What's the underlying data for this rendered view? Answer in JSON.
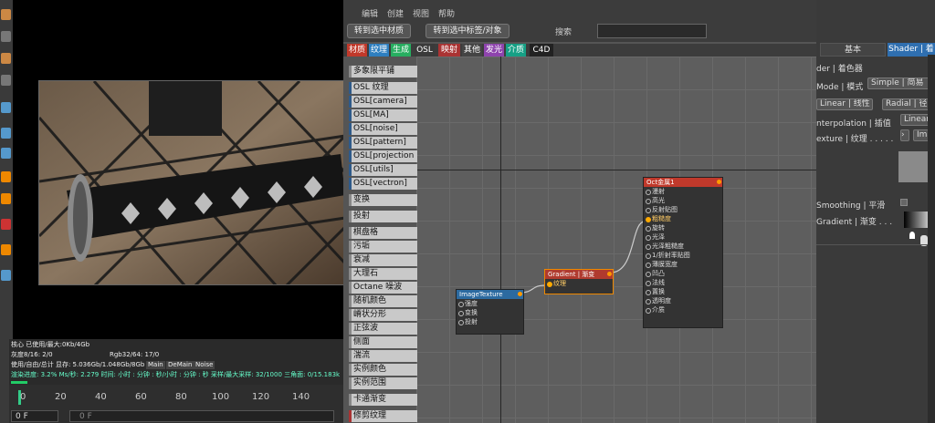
{
  "menubar": {
    "items": [
      "编辑",
      "创建",
      "视图",
      "帮助"
    ]
  },
  "toolbar": {
    "btn_material": "转到选中材质",
    "btn_tag": "转到选中标签/对象",
    "search_label": "搜索",
    "search_value": ""
  },
  "categories": [
    {
      "label": "材质",
      "color": "#c0392b"
    },
    {
      "label": "纹理",
      "color": "#2e7fc0"
    },
    {
      "label": "生成",
      "color": "#27ae60"
    },
    {
      "label": "OSL",
      "color": "#3a3a3a"
    },
    {
      "label": "映射",
      "color": "#a33"
    },
    {
      "label": "其他",
      "color": "#444"
    },
    {
      "label": "发光",
      "color": "#8e44ad"
    },
    {
      "label": "介质",
      "color": "#16a085"
    },
    {
      "label": "C4D",
      "color": "#222"
    }
  ],
  "node_list": [
    "多象限平铺",
    "OSL 纹理",
    "OSL[camera]",
    "OSL[MA]",
    "OSL[noise]",
    "OSL[pattern]",
    "OSL[projection",
    "OSL[utils]",
    "OSL[vectron]",
    "变换",
    "投射",
    "棋盘格",
    "污垢",
    "衰减",
    "大理石",
    "Octane 噪波",
    "随机颜色",
    "嵴状分形",
    "正弦波",
    "侧面",
    "湍流",
    "实例颜色",
    "实例范围",
    "卡通渐变",
    "修剪纹理"
  ],
  "nodes": {
    "image": {
      "title": "ImageTexture",
      "ports": [
        "强度",
        "变换",
        "投射"
      ]
    },
    "gradient": {
      "title": "Gradient | 渐变",
      "ports": [
        "纹理"
      ]
    },
    "metal": {
      "title": "Oct金属1",
      "ports": [
        "漫射",
        "高光",
        "反射贴图",
        "粗糙度",
        "旋转",
        "光泽",
        "光泽粗糙度",
        "1/折射率贴图",
        "薄膜宽度",
        "凹凸",
        "法线",
        "置换",
        "透明度",
        "介质"
      ],
      "selected_port": "粗糙度"
    }
  },
  "stats": {
    "cores": "核心 已使用/最大:0Kb/4Gb",
    "gpu_label": "灰度8/16: 2/0",
    "rgb": "Rgb32/64: 17/0",
    "mem": "使用/自由/总计 显存: 5.036Gb/1.048Gb/8Gb",
    "tabs": [
      "Main",
      "DeMain",
      "Noise"
    ],
    "progress": "渲染进度: 3.2%  Ms/秒: 2.279  时间: 小时 : 分钟 : 秒/小时 : 分钟 : 秒  采样/最大采样: 32/1000  三角面: 0/15.183k"
  },
  "timeline": {
    "ticks": [
      "0",
      "20",
      "40",
      "60",
      "80",
      "100",
      "120",
      "140"
    ],
    "frame_left": "0 F",
    "frame_right": "0 F"
  },
  "attr": {
    "tab_basic": "基本",
    "tab_shader": "Shader | 着",
    "shader_header": "der | 着色器",
    "mode_label": "Mode | 模式",
    "mode_value": "Simple | 简易",
    "btn_linear": "Linear | 线性",
    "btn_radial": "Radial | 径向",
    "interp_label": "nterpolation | 插值",
    "interp_value": "Linear |",
    "texture_label": "exture | 纹理 . . . . .",
    "texture_btn": "Imag",
    "smoothing_label": "Smoothing | 平滑",
    "gradient_label": "Gradient | 渐变 . . ."
  }
}
